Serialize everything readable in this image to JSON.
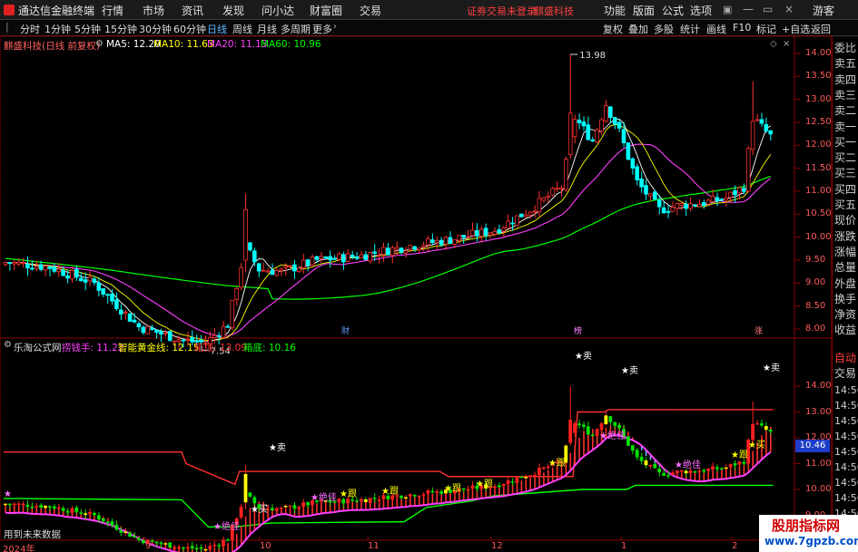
{
  "menubar": {
    "app_name": "通达信金融终端",
    "menus": [
      "行情",
      "市场",
      "资讯",
      "发现",
      "问小达",
      "财富圈",
      "交易"
    ],
    "notice": "证券交易未登录",
    "stock_name": "麒盛科技",
    "right_menus": [
      "功能",
      "版面",
      "公式",
      "选项"
    ],
    "guest": "游客"
  },
  "timeframes": [
    "分时",
    "1分钟",
    "5分钟",
    "15分钟",
    "30分钟",
    "60分钟",
    "日线",
    "周线",
    "月线",
    "多周期",
    "更多"
  ],
  "active_timeframe": "日线",
  "toolbar": [
    "复权",
    "叠加",
    "多股",
    "统计",
    "画线",
    "F10",
    "标记",
    "+自选",
    "返回"
  ],
  "main_chart": {
    "title": "麒盛科技(日线 前复权)",
    "ma": [
      {
        "label": "MA5: 12.20",
        "color": "#ffffff"
      },
      {
        "label": "MA10: 11.63",
        "color": "#ffff00"
      },
      {
        "label": "MA20: 11.13",
        "color": "#ff40ff"
      },
      {
        "label": "MA60: 10.96",
        "color": "#00ff00"
      }
    ],
    "high_label": "13.98",
    "low_label": "7.54",
    "event_markers": [
      "财",
      "榜",
      "涨"
    ]
  },
  "sub_chart": {
    "title": "乐淘公式网",
    "items": [
      {
        "label": "捞钱手: 11.22",
        "color": "#ff40ff"
      },
      {
        "label": "智能黄金线: 12.15",
        "color": "#ffff00"
      },
      {
        "label": "箱顶: 13.09",
        "color": "#ff3030"
      },
      {
        "label": "箱底: 10.16",
        "color": "#00ff00"
      }
    ],
    "signals": [
      "卖",
      "卖",
      "卖",
      "卖",
      "买",
      "买",
      "绝佳",
      "绝佳",
      "绝佳",
      "绝佳",
      "跟",
      "跟",
      "跟",
      "跟",
      "跟",
      "跟"
    ],
    "footer_note": "用到未来数据",
    "current_value": "10.46"
  },
  "right_panel": {
    "labels": [
      "委比",
      "卖五",
      "卖四",
      "卖三",
      "卖二",
      "卖一",
      "买一",
      "买二",
      "买三",
      "买四",
      "买五",
      "现价",
      "涨跌",
      "涨幅",
      "总量",
      "外盘",
      "换手",
      "净资",
      "收益"
    ],
    "lower_labels": [
      "自动",
      "交易"
    ],
    "times": [
      "14:56",
      "14:56",
      "14:56",
      "14:56",
      "14:56",
      "14:56",
      "14:56",
      "14:56",
      "14:56",
      "14:56"
    ]
  },
  "axis": {
    "main_ticks": [
      "14.00",
      "13.50",
      "13.00",
      "12.50",
      "12.00",
      "11.50",
      "11.00",
      "10.50",
      "10.00",
      "9.50",
      "9.00",
      "8.50",
      "8.00"
    ],
    "sub_ticks": [
      "14.00",
      "13.00",
      "12.00",
      "11.00",
      "10.00",
      "9.00"
    ],
    "x_labels": [
      "2024年",
      "9",
      "10",
      "11",
      "12",
      "1",
      "2"
    ]
  },
  "watermark": {
    "line1": "股朋指标网",
    "line2": "www.7gpzb.com"
  },
  "colors": {
    "up": "#ff3030",
    "down": "#00ffff",
    "frame": "#8b0000",
    "ma60": "#00ff00"
  }
}
